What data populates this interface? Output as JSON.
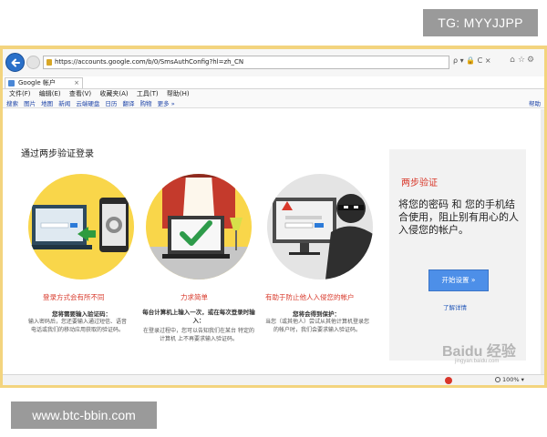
{
  "overlay": {
    "tg_badge": "TG: MYYJJPP",
    "site_badge": "www.btc-bbin.com"
  },
  "browser": {
    "url": "https://accounts.google.com/b/0/SmsAuthConfig?hl=zh_CN",
    "address_tools": "ρ ▾ 🔒 C ×",
    "tab_title": "Google 帐户",
    "tab_close": "×",
    "menu": [
      "文件(F)",
      "编辑(E)",
      "查看(V)",
      "收藏夹(A)",
      "工具(T)",
      "帮助(H)"
    ],
    "links": [
      "搜索",
      "图片",
      "地图",
      "新闻",
      "云端硬盘",
      "日历",
      "翻译",
      "购物",
      "更多 »"
    ],
    "links_right": "帮助",
    "zoom": "100%",
    "accent": "#2a70c9"
  },
  "page": {
    "title": "通过两步验证登录",
    "features": [
      {
        "title": "登录方式会有所不同",
        "subtitle": "您将需要输入验证码：",
        "body": "输入密码后，您还要输入通过短信、语音电话或我们的移动应用获取的验证码。"
      },
      {
        "title": "力求简单",
        "subtitle": "每台计算机上输入一次，或在每次登录时输入：",
        "body": "在登录过程中，您可以告知我们在某台 特定的计算机 上不再要求输入验证码。"
      },
      {
        "title": "有助于防止他人入侵您的帐户",
        "subtitle": "您将会得到保护：",
        "body": "当您（或其他人）尝试从其他计算机登录您的帐户时，我们会要求输入验证码。"
      }
    ],
    "sidebar": {
      "title": "两步验证",
      "body": "将您的密码 和 您的手机结合使用，阻止别有用心的人入侵您的帐户。",
      "button": "开始设置 »",
      "link": "了解详情"
    },
    "watermark": "Baidu 经验",
    "watermark_sub": "jingyan.baidu.com",
    "colors": {
      "feature_title": "#d8382a",
      "button": "#4d8fe8",
      "illustration_bg": "#f9d64a"
    }
  }
}
